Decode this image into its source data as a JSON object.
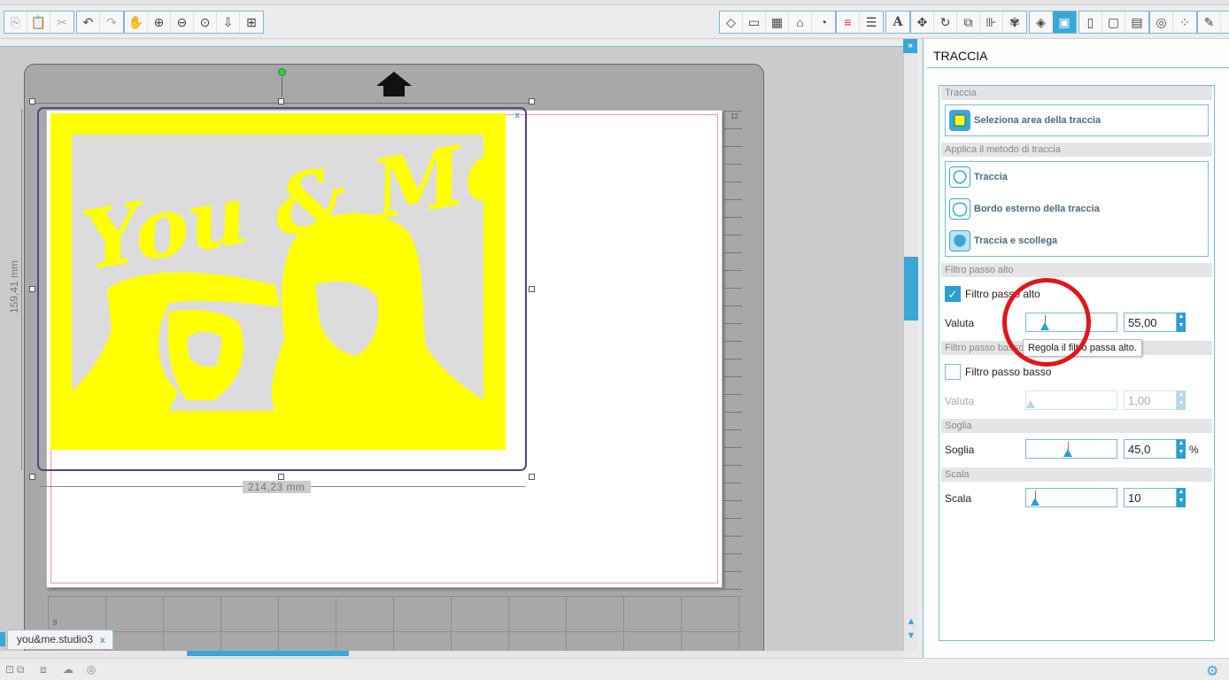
{
  "toolbar": {
    "left_icons": [
      "copy-icon",
      "paste-icon",
      "cut-icon",
      "undo-icon",
      "redo-icon",
      "pan-hand-icon",
      "zoom-in-icon",
      "zoom-out-icon",
      "zoom-selection-icon",
      "fit-to-mat-icon",
      "zoom-page-icon"
    ],
    "right_icons": [
      "eraser-icon",
      "page-setup-icon",
      "grid-icon",
      "registration-icon",
      "fill-icon",
      "line-color-icon",
      "line-style-icon",
      "text-style-icon",
      "replicate-icon",
      "transform-icon",
      "align-icon",
      "distribute-icon",
      "modify-icon",
      "offset-icon",
      "trace-icon",
      "print-cut-icon",
      "page-icon",
      "layout-icon",
      "library-icon",
      "spiral-icon",
      "sketch-icon",
      "send-icon"
    ],
    "text_style_glyph": "A"
  },
  "canvas": {
    "mat_number_top": "12",
    "mat_number_bottom": "9",
    "width_dimension": "214,23 mm",
    "height_dimension": "159,41 mm",
    "selection_close": "x",
    "image_text": "You & Me"
  },
  "document_tab": {
    "label": "you&me.studio3",
    "close": "x"
  },
  "panel": {
    "title": "TRACCIA",
    "sections": {
      "traccia_header": "Traccia",
      "select_area_label": "Seleziona area della traccia",
      "method_header": "Applica il metodo di traccia",
      "method_trace": "Traccia",
      "method_outer_edge": "Bordo esterno della traccia",
      "method_trace_detach": "Traccia e scollega",
      "high_pass_header": "Filtro passo alto",
      "high_pass_checkbox": "Filtro passo alto",
      "high_pass_checked": true,
      "high_pass_value_label": "Valuta",
      "high_pass_value": "55,00",
      "low_pass_header": "Filtro passo basso",
      "low_pass_checkbox": "Filtro passo basso",
      "low_pass_checked": false,
      "low_pass_value_label": "Valuta",
      "low_pass_value": "1,00",
      "threshold_header": "Soglia",
      "threshold_label": "Soglia",
      "threshold_value": "45,0",
      "threshold_unit": "%",
      "scale_header": "Scala",
      "scale_label": "Scala",
      "scale_value": "10"
    },
    "tooltip": "Regola il filtro passa alto."
  },
  "colors": {
    "accent": "#3aa7d6",
    "image_yellow": "#ffff00",
    "annotation_red": "#e2151b",
    "selection_border": "#4a4a88"
  }
}
